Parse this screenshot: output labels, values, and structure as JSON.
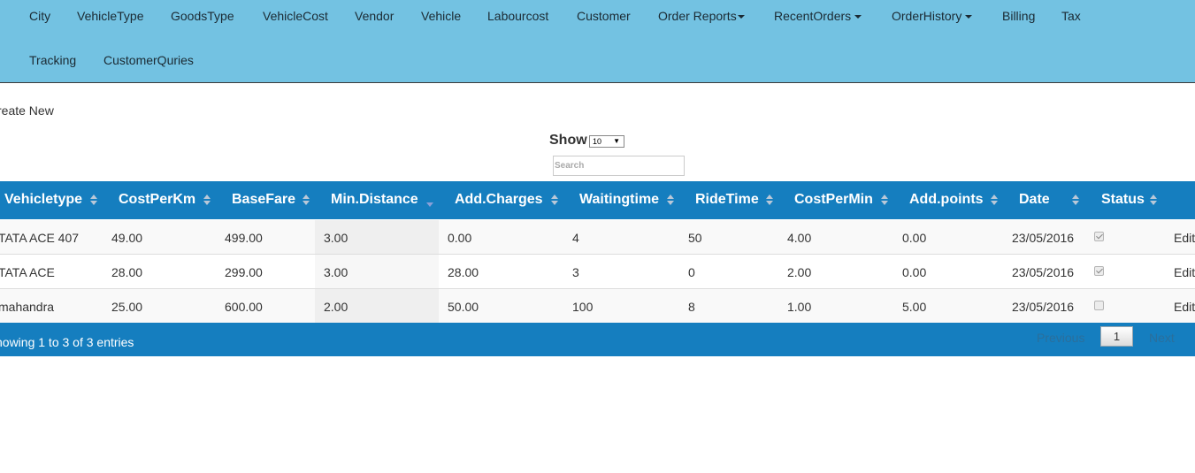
{
  "nav": {
    "items_row1": [
      {
        "label": "City"
      },
      {
        "label": "VehicleType"
      },
      {
        "label": "GoodsType"
      },
      {
        "label": "VehicleCost"
      },
      {
        "label": "Vendor"
      },
      {
        "label": "Vehicle"
      },
      {
        "label": "Labourcost"
      },
      {
        "label": "Customer"
      },
      {
        "label": "Order Reports"
      },
      {
        "label": "RecentOrders"
      },
      {
        "label": "OrderHistory"
      },
      {
        "label": "Billing"
      },
      {
        "label": "Tax"
      }
    ],
    "items_row2": [
      {
        "label": "Tracking"
      },
      {
        "label": "CustomerQuries"
      }
    ]
  },
  "create_new": "reate New",
  "length": {
    "label": "Show",
    "value": "10"
  },
  "search": {
    "placeholder": "Search"
  },
  "table": {
    "columns": [
      "Vehicletype",
      "CostPerKm",
      "BaseFare",
      "Min.Distance",
      "Add.Charges",
      "Waitingtime",
      "RideTime",
      "CostPerMin",
      "Add.points",
      "Date",
      "Status"
    ],
    "sorted_column": "Min.Distance",
    "rows": [
      {
        "vehicletype": "TATA ACE 407",
        "costperkm": "49.00",
        "basefare": "499.00",
        "mindistance": "3.00",
        "addcharges": "0.00",
        "waitingtime": "4",
        "ridetime": "50",
        "costpermin": "4.00",
        "addpoints": "0.00",
        "date": "23/05/2016",
        "status": true,
        "action": "Edit"
      },
      {
        "vehicletype": "TATA ACE",
        "costperkm": "28.00",
        "basefare": "299.00",
        "mindistance": "3.00",
        "addcharges": "28.00",
        "waitingtime": "3",
        "ridetime": "0",
        "costpermin": "2.00",
        "addpoints": "0.00",
        "date": "23/05/2016",
        "status": true,
        "action": "Edit"
      },
      {
        "vehicletype": "mahandra",
        "costperkm": "25.00",
        "basefare": "600.00",
        "mindistance": "2.00",
        "addcharges": "50.00",
        "waitingtime": "100",
        "ridetime": "8",
        "costpermin": "1.00",
        "addpoints": "5.00",
        "date": "23/05/2016",
        "status": false,
        "action": "Edit"
      }
    ]
  },
  "footer": {
    "info": "howing 1 to 3 of 3 entries",
    "prev": "Previous",
    "page": "1",
    "next": "Next"
  },
  "colors": {
    "navbar": "#73c2e2",
    "table_header": "#157ebf"
  }
}
